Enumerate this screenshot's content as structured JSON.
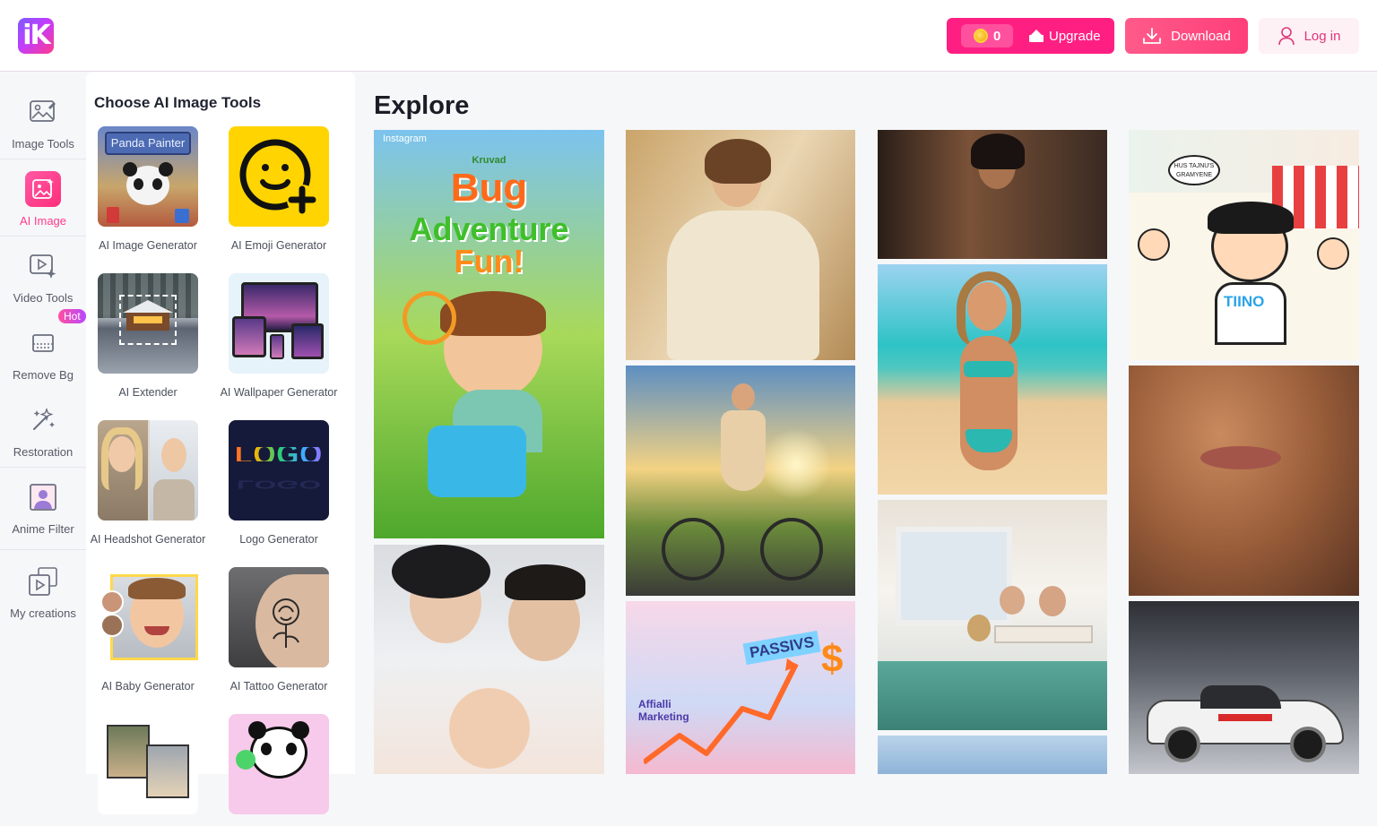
{
  "header": {
    "logo_text": "iK",
    "coins": "0",
    "upgrade_label": "Upgrade",
    "download_label": "Download",
    "login_label": "Log in"
  },
  "rail": {
    "items": [
      {
        "label": "Image Tools",
        "icon": "image-tools-icon"
      },
      {
        "label": "AI Image",
        "icon": "ai-image-icon"
      },
      {
        "label": "Video Tools",
        "icon": "video-tools-icon"
      },
      {
        "label": "Remove Bg",
        "icon": "remove-bg-icon"
      },
      {
        "label": "Restoration",
        "icon": "restoration-icon"
      },
      {
        "label": "Anime Filter",
        "icon": "anime-filter-icon"
      },
      {
        "label": "My creations",
        "icon": "my-creations-icon"
      }
    ],
    "hot_badge": "Hot",
    "active_color": "#ff3b8c"
  },
  "tools": {
    "title": "Choose AI Image Tools",
    "items": [
      {
        "label": "AI Image Generator",
        "thumb_text": "Panda Painter"
      },
      {
        "label": "AI Emoji Generator"
      },
      {
        "label": "AI Extender"
      },
      {
        "label": "AI Wallpaper Generator"
      },
      {
        "label": "AI Headshot Generator"
      },
      {
        "label": "Logo Generator",
        "thumb_text": "LOGO"
      },
      {
        "label": "AI Baby Generator"
      },
      {
        "label": "AI Tattoo Generator"
      }
    ]
  },
  "explore": {
    "title": "Explore",
    "poster": {
      "brand": "Instagram",
      "small": "Kruvad",
      "line1": "Bug",
      "line2": "Adventure",
      "line3": "Fun!"
    },
    "comic": {
      "bubble": "HUS TAJNU'S GRAMYENE",
      "shirt": "TIINO"
    },
    "finance": {
      "word1": "PASSIVS",
      "word2": "Affialli Marketing",
      "symbol": "$"
    }
  },
  "colors": {
    "brand_pink": "#ff1f82",
    "accent": "#ff3b8c"
  }
}
